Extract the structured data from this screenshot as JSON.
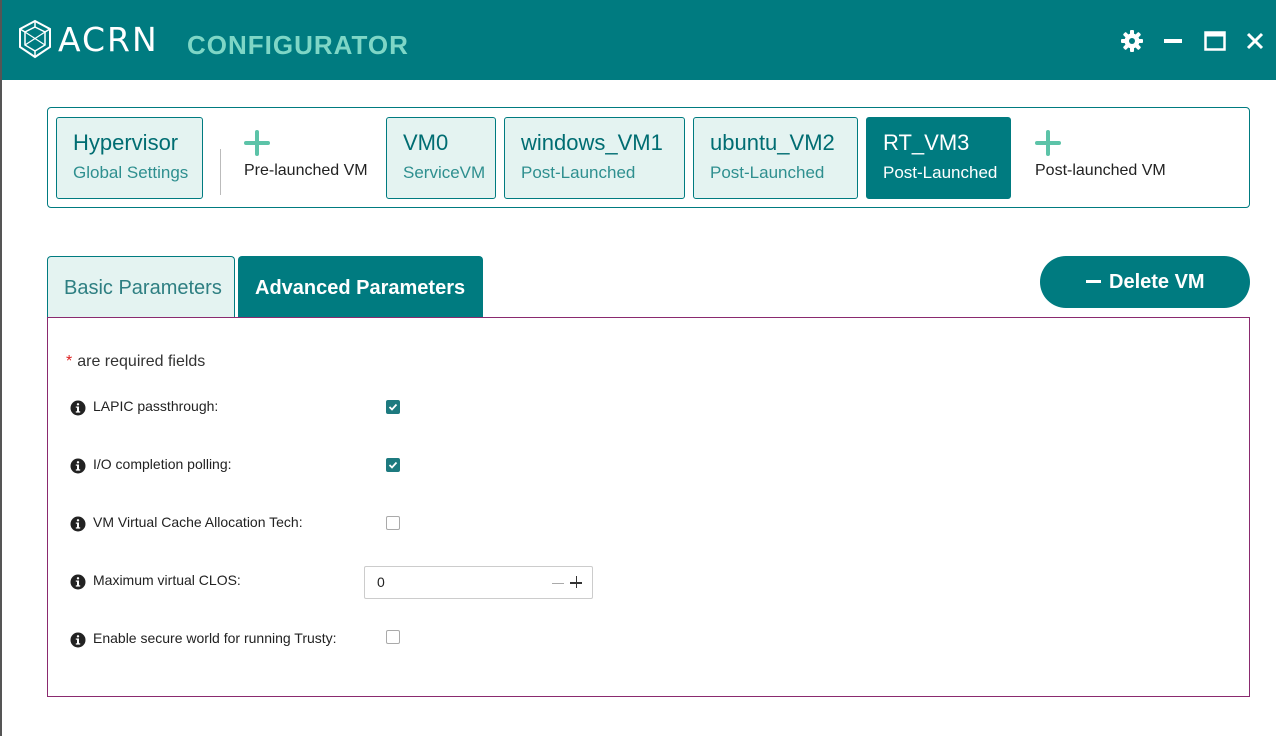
{
  "app": {
    "logo_text": "ACRN",
    "subtitle": "CONFIGURATOR",
    "brand_color": "#007b80",
    "accent_color": "#7ed6c6"
  },
  "window_controls": {
    "settings_icon": "gear-icon",
    "minimize_icon": "minimize-icon",
    "maximize_icon": "maximize-icon",
    "close_icon": "close-icon"
  },
  "vm_strip": {
    "hypervisor": {
      "name": "Hypervisor",
      "sub": "Global Settings"
    },
    "add_pre": {
      "label": "Pre-launched VM"
    },
    "vms": [
      {
        "name": "VM0",
        "sub": "ServiceVM",
        "active": false
      },
      {
        "name": "windows_VM1",
        "sub": "Post-Launched",
        "active": false
      },
      {
        "name": "ubuntu_VM2",
        "sub": "Post-Launched",
        "active": false
      },
      {
        "name": "RT_VM3",
        "sub": "Post-Launched",
        "active": true
      }
    ],
    "add_post": {
      "label": "Post-launched VM"
    }
  },
  "tabs": [
    {
      "label": "Basic Parameters",
      "active": false
    },
    {
      "label": "Advanced Parameters",
      "active": true
    }
  ],
  "delete_button": {
    "label": "Delete VM"
  },
  "form": {
    "required_star": "*",
    "required_text": "are required fields",
    "fields": [
      {
        "label": "LAPIC passthrough:",
        "type": "checkbox",
        "checked": true
      },
      {
        "label": "I/O completion polling:",
        "type": "checkbox",
        "checked": true
      },
      {
        "label": "VM Virtual Cache Allocation Tech:",
        "type": "checkbox",
        "checked": false
      },
      {
        "label": "Maximum virtual CLOS:",
        "type": "number",
        "value": "0"
      },
      {
        "label": "Enable secure world for running Trusty:",
        "type": "checkbox",
        "checked": false
      }
    ]
  }
}
